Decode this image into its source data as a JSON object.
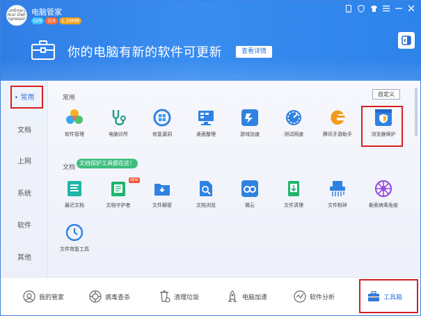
{
  "header": {
    "app_title": "电脑管家",
    "badges": {
      "level": "LV9",
      "vip": "公5",
      "accel": "1.26MB"
    },
    "logo_text": "Ordinary Your Own Impression",
    "banner_text": "你的电脑有新的软件可更新",
    "detail_button": "查看详情"
  },
  "sidebar": {
    "items": [
      {
        "label": "常用"
      },
      {
        "label": "文档"
      },
      {
        "label": "上网"
      },
      {
        "label": "系统"
      },
      {
        "label": "软件"
      },
      {
        "label": "其他"
      }
    ]
  },
  "main": {
    "section_common": "常用",
    "custom_button": "自定义",
    "section_docs": "文档",
    "tooltip": "文档保护工具都在这！",
    "new_badge": "NEW",
    "common_tools": [
      {
        "label": "软件管理",
        "icon": "software-manager-icon"
      },
      {
        "label": "电脑诊所",
        "icon": "pc-clinic-icon"
      },
      {
        "label": "修复漏洞",
        "icon": "vulnerability-fix-icon"
      },
      {
        "label": "桌面整理",
        "icon": "desktop-organize-icon"
      },
      {
        "label": "游戏加速",
        "icon": "game-accelerate-icon"
      },
      {
        "label": "测试网速",
        "icon": "speed-test-icon"
      },
      {
        "label": "腾讯手游助手",
        "icon": "mobile-game-assistant-icon"
      },
      {
        "label": "浏览器保护",
        "icon": "browser-protection-icon"
      }
    ],
    "doc_tools": [
      {
        "label": "最近文档",
        "icon": "recent-docs-icon"
      },
      {
        "label": "文档守护者",
        "icon": "doc-guardian-icon"
      },
      {
        "label": "文件解密",
        "icon": "file-decrypt-icon"
      },
      {
        "label": "文档浏览",
        "icon": "doc-browse-icon"
      },
      {
        "label": "微云",
        "icon": "weiyun-icon"
      },
      {
        "label": "文件清理",
        "icon": "file-clean-icon"
      },
      {
        "label": "文件粉碎",
        "icon": "file-shred-icon"
      },
      {
        "label": "勒索病毒免疫",
        "icon": "ransomware-immune-icon"
      },
      {
        "label": "文件恢复工具",
        "icon": "file-recovery-icon"
      }
    ]
  },
  "bottom_bar": {
    "items": [
      {
        "label": "我的管家",
        "icon": "butler-icon"
      },
      {
        "label": "病毒查杀",
        "icon": "virus-scan-icon"
      },
      {
        "label": "清理垃圾",
        "icon": "clean-junk-icon"
      },
      {
        "label": "电脑加速",
        "icon": "pc-accelerate-icon"
      },
      {
        "label": "软件分析",
        "icon": "software-analysis-icon"
      },
      {
        "label": "工具箱",
        "icon": "toolbox-icon"
      }
    ]
  },
  "colors": {
    "brand_blue": "#2f7ee6",
    "highlight_red": "#d41f1f"
  }
}
